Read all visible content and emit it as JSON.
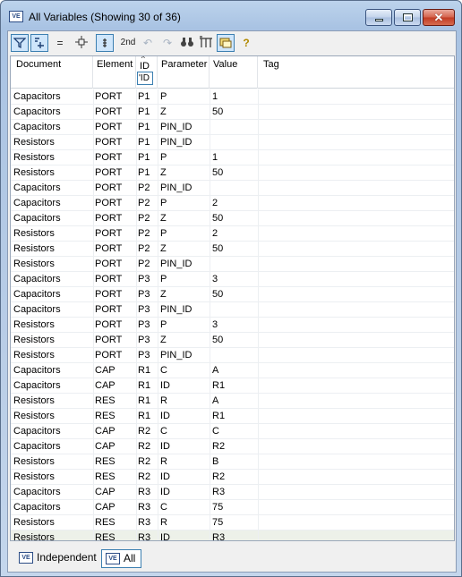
{
  "window": {
    "title": "All Variables (Showing 30 of 36)",
    "close_glyph": "✕"
  },
  "toolbar": {
    "buttons": [
      {
        "name": "filter-icon",
        "glyph": "⛉"
      },
      {
        "name": "add-variable-icon",
        "glyph": "⊞"
      },
      {
        "name": "equals-icon",
        "glyph": "="
      },
      {
        "name": "crosshair-icon",
        "glyph": "⌖"
      },
      {
        "name": "column-icon",
        "glyph": "⦙"
      },
      {
        "name": "second-order-icon",
        "glyph": "2nd"
      },
      {
        "name": "undo-icon",
        "glyph": "↶"
      },
      {
        "name": "redo-icon",
        "glyph": "↷"
      },
      {
        "name": "find-icon",
        "glyph": "🔍"
      },
      {
        "name": "columns-icon",
        "glyph": "⊟"
      },
      {
        "name": "window-icon",
        "glyph": "▣"
      },
      {
        "name": "help-icon",
        "glyph": "?"
      }
    ]
  },
  "table": {
    "headers": {
      "document": "Document",
      "element": "Element",
      "id": "ID",
      "parameter": "Parameter",
      "value": "Value",
      "tag": "Tag"
    },
    "id_filter": "'ID",
    "rows": [
      {
        "document": "Capacitors",
        "element": "PORT",
        "id": "P1",
        "parameter": "P",
        "value": "1"
      },
      {
        "document": "Capacitors",
        "element": "PORT",
        "id": "P1",
        "parameter": "Z",
        "value": "50"
      },
      {
        "document": "Capacitors",
        "element": "PORT",
        "id": "P1",
        "parameter": "PIN_ID",
        "value": ""
      },
      {
        "document": "Resistors",
        "element": "PORT",
        "id": "P1",
        "parameter": "PIN_ID",
        "value": ""
      },
      {
        "document": "Resistors",
        "element": "PORT",
        "id": "P1",
        "parameter": "P",
        "value": "1"
      },
      {
        "document": "Resistors",
        "element": "PORT",
        "id": "P1",
        "parameter": "Z",
        "value": "50"
      },
      {
        "document": "Capacitors",
        "element": "PORT",
        "id": "P2",
        "parameter": "PIN_ID",
        "value": ""
      },
      {
        "document": "Capacitors",
        "element": "PORT",
        "id": "P2",
        "parameter": "P",
        "value": "2"
      },
      {
        "document": "Capacitors",
        "element": "PORT",
        "id": "P2",
        "parameter": "Z",
        "value": "50"
      },
      {
        "document": "Resistors",
        "element": "PORT",
        "id": "P2",
        "parameter": "P",
        "value": "2"
      },
      {
        "document": "Resistors",
        "element": "PORT",
        "id": "P2",
        "parameter": "Z",
        "value": "50"
      },
      {
        "document": "Resistors",
        "element": "PORT",
        "id": "P2",
        "parameter": "PIN_ID",
        "value": ""
      },
      {
        "document": "Capacitors",
        "element": "PORT",
        "id": "P3",
        "parameter": "P",
        "value": "3"
      },
      {
        "document": "Capacitors",
        "element": "PORT",
        "id": "P3",
        "parameter": "Z",
        "value": "50"
      },
      {
        "document": "Capacitors",
        "element": "PORT",
        "id": "P3",
        "parameter": "PIN_ID",
        "value": ""
      },
      {
        "document": "Resistors",
        "element": "PORT",
        "id": "P3",
        "parameter": "P",
        "value": "3"
      },
      {
        "document": "Resistors",
        "element": "PORT",
        "id": "P3",
        "parameter": "Z",
        "value": "50"
      },
      {
        "document": "Resistors",
        "element": "PORT",
        "id": "P3",
        "parameter": "PIN_ID",
        "value": ""
      },
      {
        "document": "Capacitors",
        "element": "CAP",
        "id": "R1",
        "parameter": "C",
        "value": "A"
      },
      {
        "document": "Capacitors",
        "element": "CAP",
        "id": "R1",
        "parameter": "ID",
        "value": "R1"
      },
      {
        "document": "Resistors",
        "element": "RES",
        "id": "R1",
        "parameter": "R",
        "value": "A"
      },
      {
        "document": "Resistors",
        "element": "RES",
        "id": "R1",
        "parameter": "ID",
        "value": "R1"
      },
      {
        "document": "Capacitors",
        "element": "CAP",
        "id": "R2",
        "parameter": "C",
        "value": "C"
      },
      {
        "document": "Capacitors",
        "element": "CAP",
        "id": "R2",
        "parameter": "ID",
        "value": "R2"
      },
      {
        "document": "Resistors",
        "element": "RES",
        "id": "R2",
        "parameter": "R",
        "value": "B"
      },
      {
        "document": "Resistors",
        "element": "RES",
        "id": "R2",
        "parameter": "ID",
        "value": "R2"
      },
      {
        "document": "Capacitors",
        "element": "CAP",
        "id": "R3",
        "parameter": "ID",
        "value": "R3"
      },
      {
        "document": "Capacitors",
        "element": "CAP",
        "id": "R3",
        "parameter": "C",
        "value": "75"
      },
      {
        "document": "Resistors",
        "element": "RES",
        "id": "R3",
        "parameter": "R",
        "value": "75"
      },
      {
        "document": "Resistors",
        "element": "RES",
        "id": "R3",
        "parameter": "ID",
        "value": "R3"
      }
    ]
  },
  "tabs": [
    {
      "label": "Independent",
      "active": false
    },
    {
      "label": "All",
      "active": true
    }
  ],
  "icons": {
    "window_icon_text": "VE"
  }
}
